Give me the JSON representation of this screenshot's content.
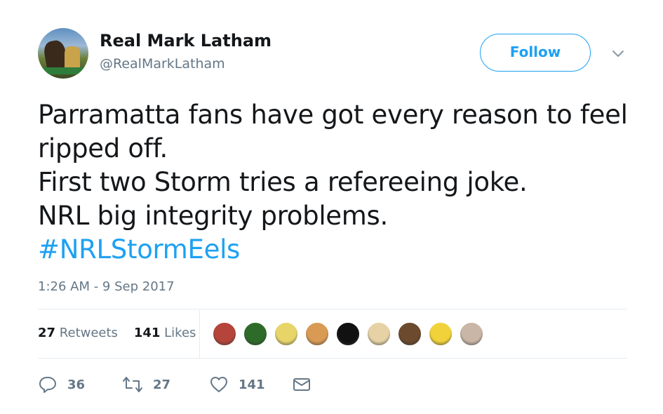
{
  "user": {
    "display_name": "Real Mark Latham",
    "handle": "@RealMarkLatham"
  },
  "follow_button": {
    "label": "Follow"
  },
  "tweet": {
    "lines": [
      "Parramatta fans have got every reason to feel",
      "ripped off.",
      "First two Storm tries a refereeing joke.",
      "NRL big integrity problems."
    ],
    "hashtag": "#NRLStormEels",
    "timestamp": "1:26 AM - 9 Sep 2017"
  },
  "stats": {
    "retweets_count": "27",
    "retweets_label": "Retweets",
    "likes_count": "141",
    "likes_label": "Likes"
  },
  "liker_avatars": [
    {
      "icon": "liker-avatar-1",
      "color": "#b5443a"
    },
    {
      "icon": "liker-avatar-2",
      "color": "#2e6b2a"
    },
    {
      "icon": "liker-avatar-3",
      "color": "#e7d56a"
    },
    {
      "icon": "liker-avatar-4",
      "color": "#d99a54"
    },
    {
      "icon": "liker-avatar-5",
      "color": "#111111"
    },
    {
      "icon": "liker-avatar-6",
      "color": "#e6d2a4"
    },
    {
      "icon": "liker-avatar-7",
      "color": "#6b4a2e"
    },
    {
      "icon": "liker-avatar-8",
      "color": "#f1d23a"
    },
    {
      "icon": "liker-avatar-9",
      "color": "#c9b6a6"
    }
  ],
  "actions": {
    "reply_count": "36",
    "retweet_count": "27",
    "like_count": "141"
  },
  "colors": {
    "accent": "#1da1f2",
    "secondary_text": "#657786",
    "primary_text": "#14171a",
    "divider": "#e6ecf0"
  }
}
